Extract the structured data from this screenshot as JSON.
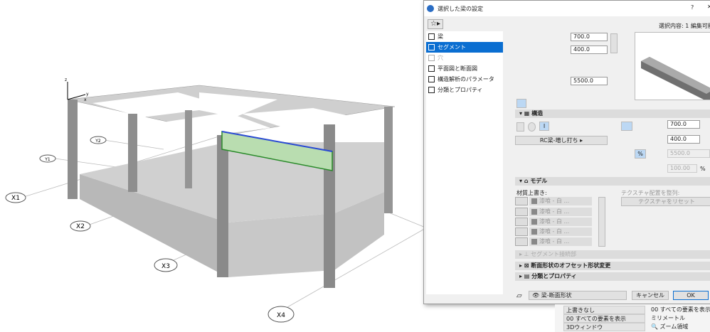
{
  "viewport": {
    "grid_labels": [
      "X1",
      "X2",
      "X3",
      "X4",
      "Y1",
      "Y2"
    ],
    "axes": [
      "x",
      "y",
      "z"
    ]
  },
  "dialog": {
    "title": "選択した梁の設定",
    "help": "?",
    "close": "✕",
    "selection_info": "選択内容: 1 編集可能:",
    "nav": [
      {
        "label": "梁",
        "icon": "beam-icon"
      },
      {
        "label": "セグメント",
        "icon": "segment-icon"
      },
      {
        "label": "穴",
        "icon": "hole-icon"
      },
      {
        "label": "平面図と断面図",
        "icon": "floor-plan-icon"
      },
      {
        "label": "構造解析のパラメータ",
        "icon": "structural-icon"
      },
      {
        "label": "分類とプロパティ",
        "icon": "classification-icon"
      }
    ],
    "top": {
      "height": "700.0",
      "width": "400.0",
      "length": "5500.0"
    },
    "structure": {
      "title": "構造",
      "building_material": "RC梁-増し打ち",
      "height": "700.0",
      "width": "400.0",
      "length": "5500.0",
      "percent": "100.00",
      "percent_unit": "%"
    },
    "model": {
      "title": "モデル",
      "override_label": "材質上書き:",
      "materials": [
        "漆喰 - 白 ...",
        "漆喰 - 白 ...",
        "漆喰 - 白 ...",
        "漆喰 - 白 ...",
        "漆喰 - 白 ..."
      ],
      "texture_label": "テクスチャ配置を整列:",
      "texture_reset": "テクスチャをリセット"
    },
    "sections": [
      "セグメント接続部",
      "断面形状のオフセット形状変更",
      "分類とプロパティ"
    ],
    "footer": {
      "layer": "梁-断面形状",
      "cancel": "キャンセル",
      "ok": "OK"
    }
  },
  "bottom_bar": {
    "override": "上書きなし",
    "layer_combo": "00 すべての要素を表示",
    "window": "3Dウィンドウ",
    "show_all": "00 すべての要素を表示",
    "unit": "ミリメートル",
    "zoom": "ズーム領域"
  }
}
